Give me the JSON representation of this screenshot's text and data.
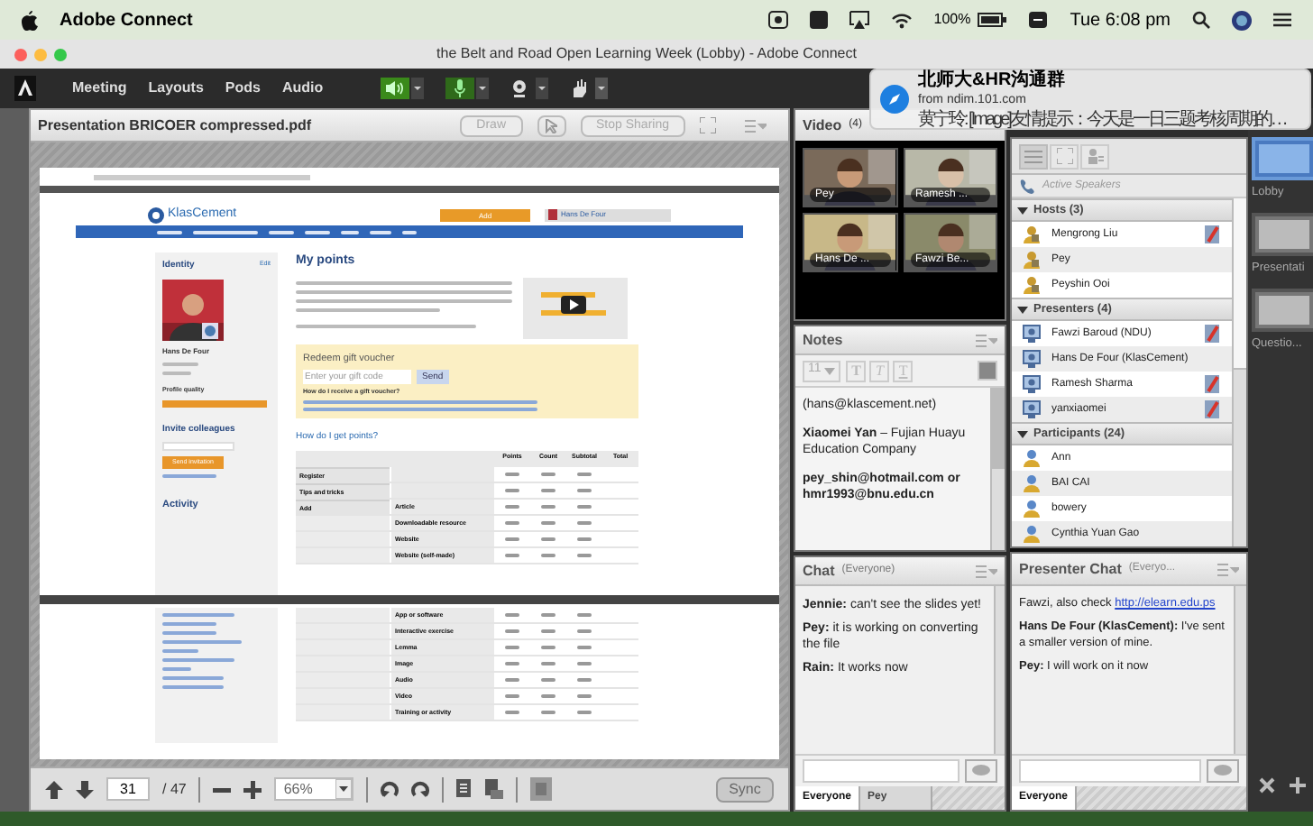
{
  "menu_bar": {
    "app": "Adobe Connect",
    "battery": "100%",
    "clock": "Tue 6:08 pm"
  },
  "window": {
    "title": "the Belt and Road Open Learning Week (Lobby) - Adobe Connect"
  },
  "toolbar": {
    "menus": [
      "Meeting",
      "Layouts",
      "Pods",
      "Audio"
    ]
  },
  "notification": {
    "title": "北师大&HR沟通群",
    "source": "from ndim.101.com",
    "message": "黄宁玲: [Image]友情提示：今天是一日三题考核周期的…"
  },
  "presentation": {
    "title": "Presentation BRICOER compressed.pdf",
    "buttons": [
      {
        "label": "Draw",
        "disabled": true
      },
      {
        "label": "Stop Sharing",
        "disabled": true
      }
    ],
    "page": "31",
    "page_total": "/ 47",
    "zoom": "66%",
    "sync": "Sync",
    "document": {
      "logo": "KlasCement",
      "add": "Add",
      "user": "Hans De Four",
      "identity": "Identity",
      "edit": "Edit",
      "profile_name": "Hans De Four",
      "profile_quality": "Profile quality",
      "invite": "Invite colleagues",
      "send_invitation": "Send invitation",
      "activity": "Activity",
      "heading": "My points",
      "voucher_title": "Redeem gift voucher",
      "voucher_placeholder": "Enter your gift code",
      "voucher_send": "Send",
      "voucher_question": "How do I receive a gift voucher?",
      "points_heading": "How do I get points?",
      "columns": [
        "Points",
        "Count",
        "Subtotal",
        "Total"
      ],
      "rows_page_1": [
        {
          "kind": "main",
          "label": "Register"
        },
        {
          "kind": "main",
          "label": "Tips and tricks"
        },
        {
          "kind": "main",
          "label": "Add",
          "item": "Article"
        },
        {
          "kind": "sub",
          "item": "Downloadable resource"
        },
        {
          "kind": "sub",
          "item": "Website"
        },
        {
          "kind": "sub",
          "item": "Website (self-made)"
        }
      ],
      "rows_page_2": [
        {
          "kind": "sub",
          "item": "App or software"
        },
        {
          "kind": "sub",
          "item": "Interactive exercise"
        },
        {
          "kind": "sub",
          "item": "Lemma"
        },
        {
          "kind": "sub",
          "item": "Image"
        },
        {
          "kind": "sub",
          "item": "Audio"
        },
        {
          "kind": "sub",
          "item": "Video"
        },
        {
          "kind": "sub",
          "item": "Training or activity"
        }
      ]
    }
  },
  "video": {
    "title": "Video",
    "count": "(4)",
    "tiles": [
      {
        "name": "Pey"
      },
      {
        "name": "Ramesh ..."
      },
      {
        "name": "Hans De ..."
      },
      {
        "name": "Fawzi Be..."
      }
    ]
  },
  "notes": {
    "title": "Notes",
    "font_size": "11",
    "format_buttons": [
      "T",
      "T",
      "T"
    ],
    "paragraphs": [
      "(hans@klascement.net)",
      "**Xiaomei Yan** – Fujian Huayu Education Company",
      "**pey_shin@hotmail.com or hmr1993@bnu.edu.cn**"
    ]
  },
  "chat": {
    "title": "Chat",
    "audience": "(Everyone)",
    "messages": [
      {
        "text": "**Jennie:** can't see the slides yet!"
      },
      {
        "text": "**Pey:** it is working on converting the file"
      },
      {
        "text": "**Rain:** It works now"
      }
    ],
    "tabs": [
      {
        "label": "Everyone",
        "selected": true
      },
      {
        "label": "Pey",
        "selected": false
      }
    ]
  },
  "attendees": {
    "active_speakers": "Active Speakers",
    "groups": [
      {
        "label": "Hosts (3)",
        "kind": "host",
        "expanded": true,
        "children": [
          {
            "name": "Mengrong Liu",
            "rights": true
          },
          {
            "name": "Pey",
            "rights": false
          },
          {
            "name": "Peyshin Ooi",
            "rights": false
          }
        ]
      },
      {
        "label": "Presenters (4)",
        "kind": "presenter",
        "expanded": true,
        "children": [
          {
            "name": "Fawzi Baroud (NDU)",
            "rights": true
          },
          {
            "name": "Hans De Four (KlasCement)",
            "rights": false
          },
          {
            "name": "Ramesh Sharma",
            "rights": true
          },
          {
            "name": "yanxiaomei",
            "rights": true
          }
        ]
      },
      {
        "label": "Participants (24)",
        "kind": "participant",
        "expanded": true,
        "children": [
          {
            "name": "Ann",
            "rights": false
          },
          {
            "name": "BAI CAI",
            "rights": false
          },
          {
            "name": "bowery",
            "rights": false
          },
          {
            "name": "Cynthia Yuan Gao",
            "rights": false
          }
        ]
      }
    ]
  },
  "layouts": [
    {
      "label": "Lobby",
      "selected": true
    },
    {
      "label": "Presentati",
      "selected": false
    },
    {
      "label": "Questio...",
      "selected": false
    }
  ],
  "presenter_chat": {
    "title": "Presenter Chat",
    "audience": "(Everyo...",
    "messages": [
      {
        "text": "Fawzi, also check",
        "link": "http://elearn.edu.ps"
      },
      {
        "text": "**Hans De Four (KlasCement):** I've sent a smaller version of mine."
      },
      {
        "text": "**Pey:** I will work on it now"
      }
    ],
    "tabs": [
      {
        "label": "Everyone",
        "selected": true
      }
    ]
  }
}
